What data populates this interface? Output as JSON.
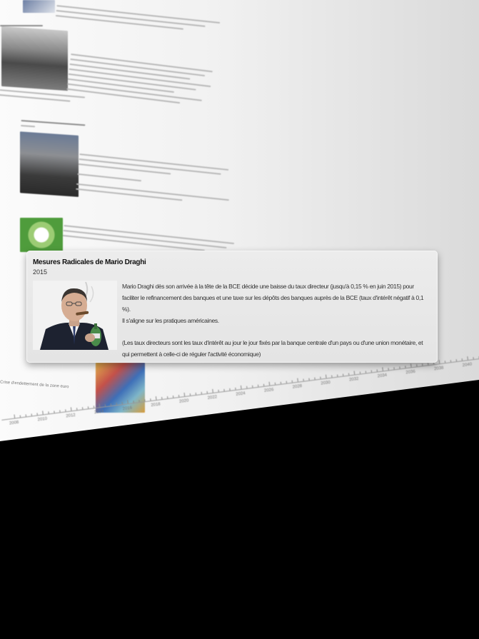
{
  "card": {
    "title": "Mesures Radicales de Mario Draghi",
    "year": "2015",
    "paragraphs": [
      "Mario Draghi dès son arrivée à la tête de la BCE décide une baisse du taux directeur (jusqu'à 0,15 % en juin 2015) pour faciliter le refinancement des banques et une taxe sur les dépôts des banques auprès de la BCE (taux d'intérêt négatif à 0,1 %).",
      "Il s'aligne sur les pratiques américaines.",
      "(Les taux directeurs sont les taux d'intérêt au jour le jour fixés par la banque centrale d'un pays ou d'une union monétaire, et qui permettent à celle-ci de réguler l'activité économique)"
    ]
  },
  "background": {
    "left_caption": "Crise d'endettement de la zone euro",
    "years": [
      "2008",
      "2010",
      "2012",
      "2014",
      "2016",
      "2018",
      "2020",
      "2022",
      "2024",
      "2026",
      "2028",
      "2030",
      "2032",
      "2034",
      "2036",
      "2038",
      "2040"
    ]
  }
}
